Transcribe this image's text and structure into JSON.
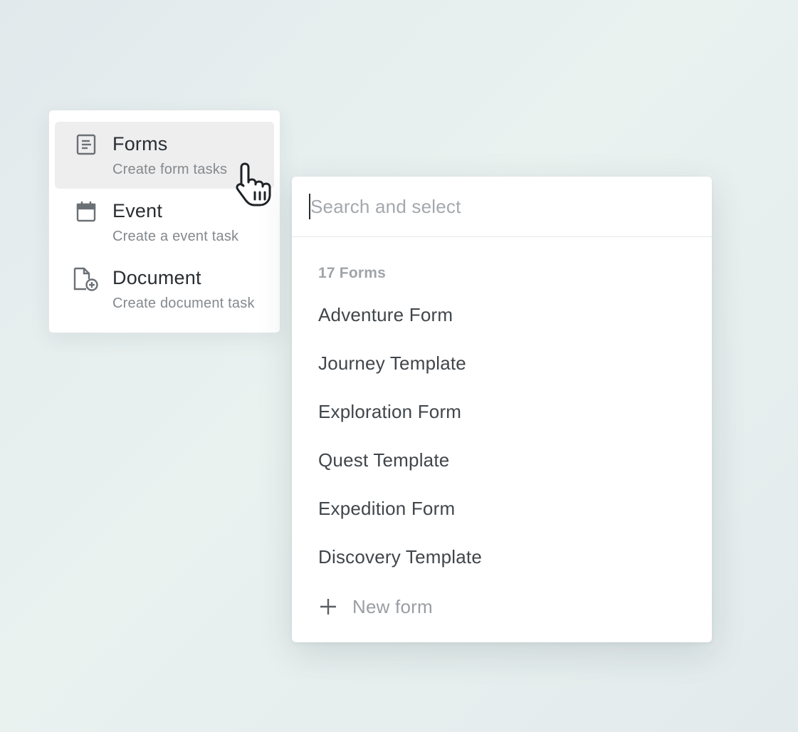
{
  "task_menu": {
    "items": [
      {
        "icon": "form-icon",
        "title": "Forms",
        "subtitle": "Create form tasks",
        "active": true
      },
      {
        "icon": "calendar-icon",
        "title": "Event",
        "subtitle": "Create a event task",
        "active": false
      },
      {
        "icon": "document-add-icon",
        "title": "Document",
        "subtitle": "Create document task",
        "active": false
      }
    ]
  },
  "picker": {
    "search_placeholder": "Search and select",
    "search_value": "",
    "count_label": "17 Forms",
    "forms": [
      "Adventure Form",
      "Journey Template",
      "Exploration Form",
      "Quest Template",
      "Expedition Form",
      "Discovery Template"
    ],
    "new_form_label": "New form",
    "new_form_icon": "plus-icon"
  },
  "cursor_icon": "hand-pointer-icon"
}
